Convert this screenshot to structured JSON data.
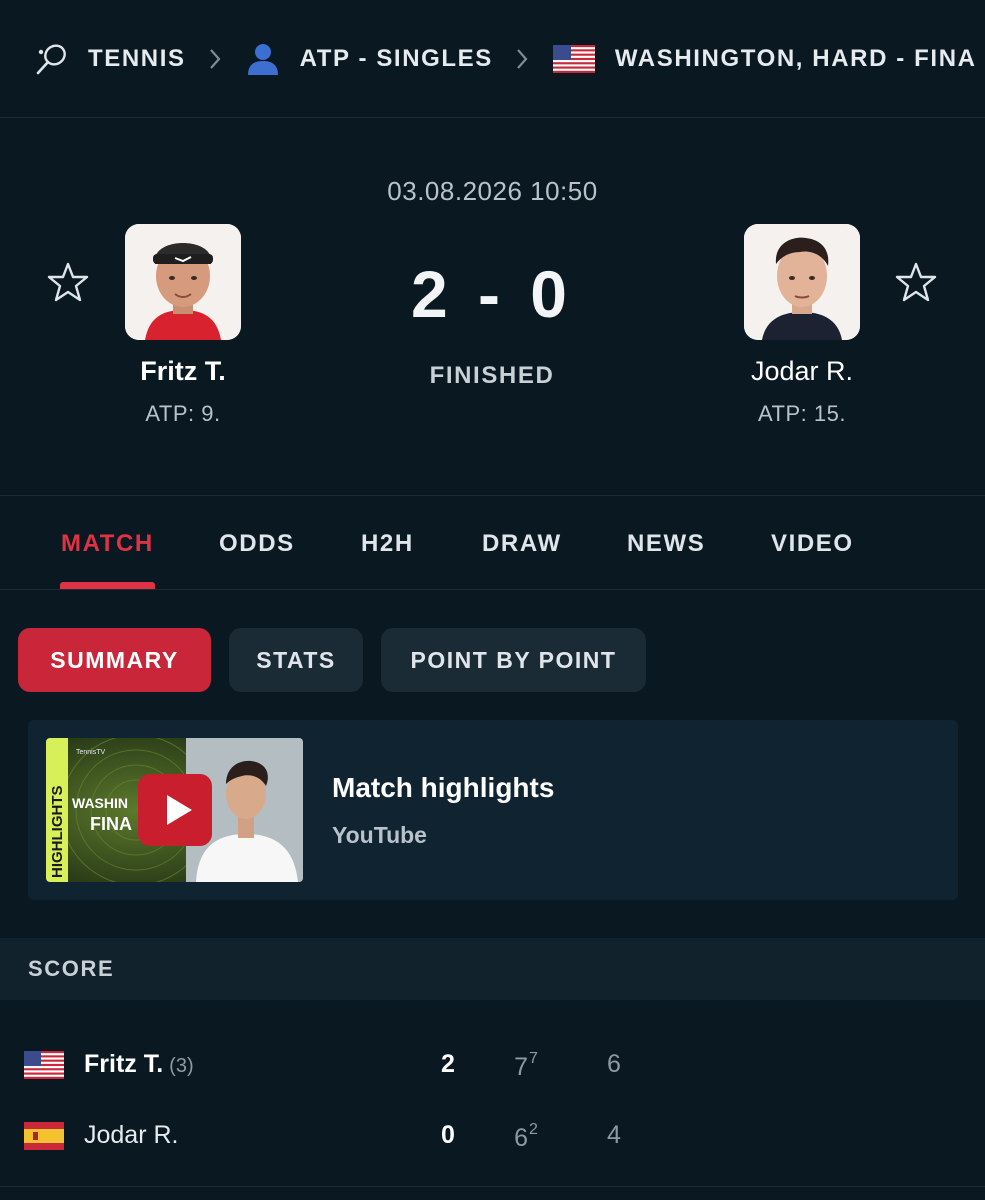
{
  "breadcrumb": [
    {
      "label": "TENNIS",
      "icon": "tennis-racket-icon"
    },
    {
      "label": "ATP - SINGLES",
      "icon": "player-icon"
    },
    {
      "label": "WASHINGTON, HARD - FINA",
      "icon": "usa-flag-icon"
    }
  ],
  "match": {
    "datetime": "03.08.2026 10:50",
    "score": "2 - 0",
    "status": "FINISHED",
    "home": {
      "name": "Fritz T.",
      "rank": "ATP: 9."
    },
    "away": {
      "name": "Jodar R.",
      "rank": "ATP: 15."
    }
  },
  "tabs": [
    "MATCH",
    "ODDS",
    "H2H",
    "DRAW",
    "NEWS",
    "VIDEO"
  ],
  "active_tab": "MATCH",
  "subtabs": [
    "SUMMARY",
    "STATS",
    "POINT BY POINT"
  ],
  "active_subtab": "SUMMARY",
  "highlight": {
    "title": "Match highlights",
    "source": "YouTube",
    "thumb_lettering": [
      "HIGHLIGHTS",
      "WASHIN",
      "FINA",
      "TennisTV"
    ]
  },
  "score_section": {
    "label": "SCORE",
    "rows": [
      {
        "name": "Fritz T.",
        "seed": "(3)",
        "sets": "2",
        "set1": "7",
        "set1_tb": "7",
        "set2": "6",
        "flag": "usa"
      },
      {
        "name": "Jodar R.",
        "seed": "",
        "sets": "0",
        "set1": "6",
        "set1_tb": "2",
        "set2": "4",
        "flag": "spain"
      }
    ]
  },
  "colors": {
    "background": "#0a1821",
    "accent": "#e03245",
    "pill_active": "#c9263a",
    "pill": "#1b2b36",
    "card": "#0f2330"
  }
}
